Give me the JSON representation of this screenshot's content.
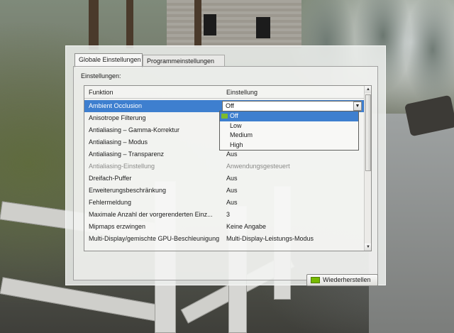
{
  "tabs": [
    {
      "label": "Globale Einstellungen",
      "active": true
    },
    {
      "label": "Programmeinstellungen",
      "active": false
    }
  ],
  "settings_label": "Einstellungen:",
  "columns": {
    "function": "Funktion",
    "setting": "Einstellung"
  },
  "rows": [
    {
      "function": "Ambient Occlusion",
      "value": "Off",
      "state": "selected"
    },
    {
      "function": "Anisotrope Filterung",
      "value": "",
      "state": "normal"
    },
    {
      "function": "Antialiasing – Gamma-Korrektur",
      "value": "",
      "state": "normal"
    },
    {
      "function": "Antialiasing – Modus",
      "value": "",
      "state": "normal"
    },
    {
      "function": "Antialiasing – Transparenz",
      "value": "Aus",
      "state": "normal"
    },
    {
      "function": "Antialiasing-Einstellung",
      "value": "Anwendungsgesteuert",
      "state": "disabled"
    },
    {
      "function": "Dreifach-Puffer",
      "value": "Aus",
      "state": "normal"
    },
    {
      "function": "Erweiterungsbeschränkung",
      "value": "Aus",
      "state": "normal"
    },
    {
      "function": "Fehlermeldung",
      "value": "Aus",
      "state": "normal"
    },
    {
      "function": "Maximale Anzahl der vorgerenderten Einz...",
      "value": "3",
      "state": "normal"
    },
    {
      "function": "Mipmaps erzwingen",
      "value": "Keine Angabe",
      "state": "normal"
    },
    {
      "function": "Multi-Display/gemischte GPU-Beschleunigung",
      "value": "Multi-Display-Leistungs-Modus",
      "state": "normal"
    }
  ],
  "dropdown": {
    "selected": "Off",
    "options": [
      "Off",
      "Low",
      "Medium",
      "High"
    ]
  },
  "restore_button": "Wiederherstellen",
  "colors": {
    "selection": "#3e7fcf",
    "nvidia_green": "#76b900"
  }
}
